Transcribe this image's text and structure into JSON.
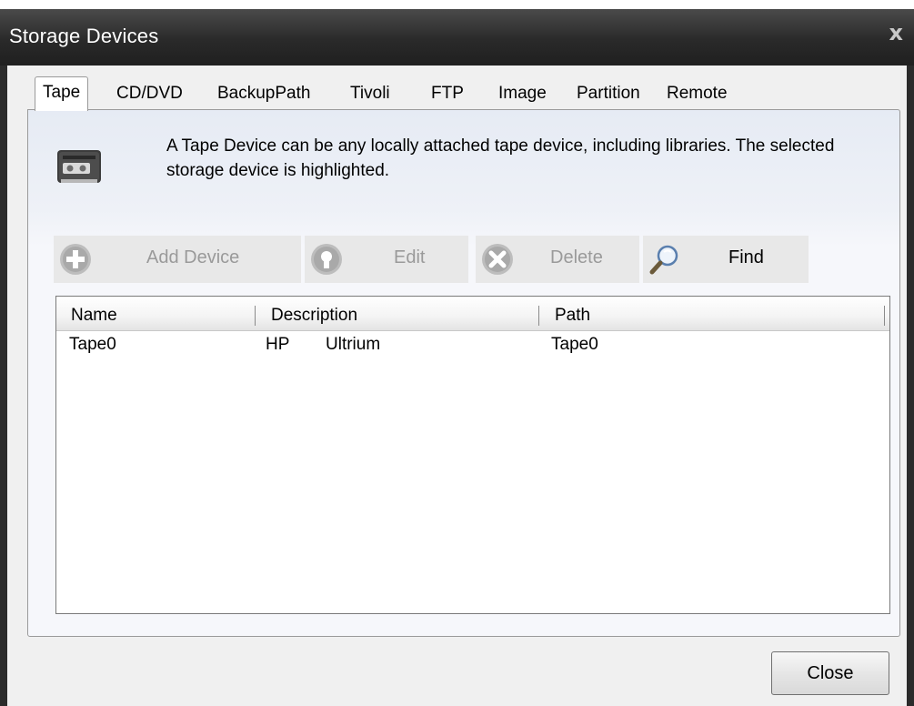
{
  "window": {
    "title": "Storage Devices",
    "close_glyph": "x"
  },
  "tabs": [
    {
      "label": "Tape",
      "active": true
    },
    {
      "label": "CD/DVD"
    },
    {
      "label": "BackupPath"
    },
    {
      "label": "Tivoli"
    },
    {
      "label": "FTP"
    },
    {
      "label": "Image"
    },
    {
      "label": "Partition"
    },
    {
      "label": "Remote"
    }
  ],
  "panel": {
    "icon": "tape-cassette-icon",
    "description": "A Tape Device can be any locally attached tape device, including libraries.  The selected storage device is highlighted."
  },
  "toolbar": {
    "add_label": "Add Device",
    "add_icon": "plus-circle-icon",
    "edit_label": "Edit",
    "edit_icon": "edit-circle-icon",
    "delete_label": "Delete",
    "delete_icon": "x-circle-icon",
    "find_label": "Find",
    "find_icon": "magnifier-icon"
  },
  "table": {
    "columns": [
      "Name",
      "Description",
      "Path"
    ],
    "rows": [
      {
        "name": "Tape0",
        "description_vendor": "HP",
        "description_model": "Ultrium",
        "path": "Tape0"
      }
    ]
  },
  "footer": {
    "close_label": "Close"
  },
  "colors": {
    "titlebar": "#2a2a2a",
    "disabled_text": "#9a9a9a",
    "panel_header": "#e6ebf4"
  }
}
